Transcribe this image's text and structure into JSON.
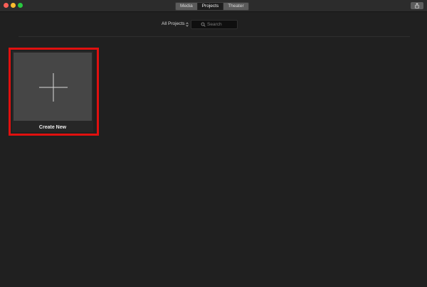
{
  "window": {
    "tabs": [
      {
        "label": "Media",
        "selected": false
      },
      {
        "label": "Projects",
        "selected": true
      },
      {
        "label": "Theater",
        "selected": false
      }
    ],
    "share_icon": "share-icon"
  },
  "toolbar": {
    "filter": {
      "value": "All Projects",
      "icon": "chevron-updown-icon"
    },
    "search": {
      "placeholder": "Search",
      "value": "",
      "icon": "search-icon"
    }
  },
  "projects": {
    "create_new": {
      "label": "Create New",
      "icon": "plus-icon",
      "highlight_color": "#e0100f"
    }
  },
  "colors": {
    "background": "#202020",
    "tile": "#464646",
    "traffic_close": "#fc5f57",
    "traffic_minimize": "#fdbc2e",
    "traffic_maximize": "#28c840"
  }
}
